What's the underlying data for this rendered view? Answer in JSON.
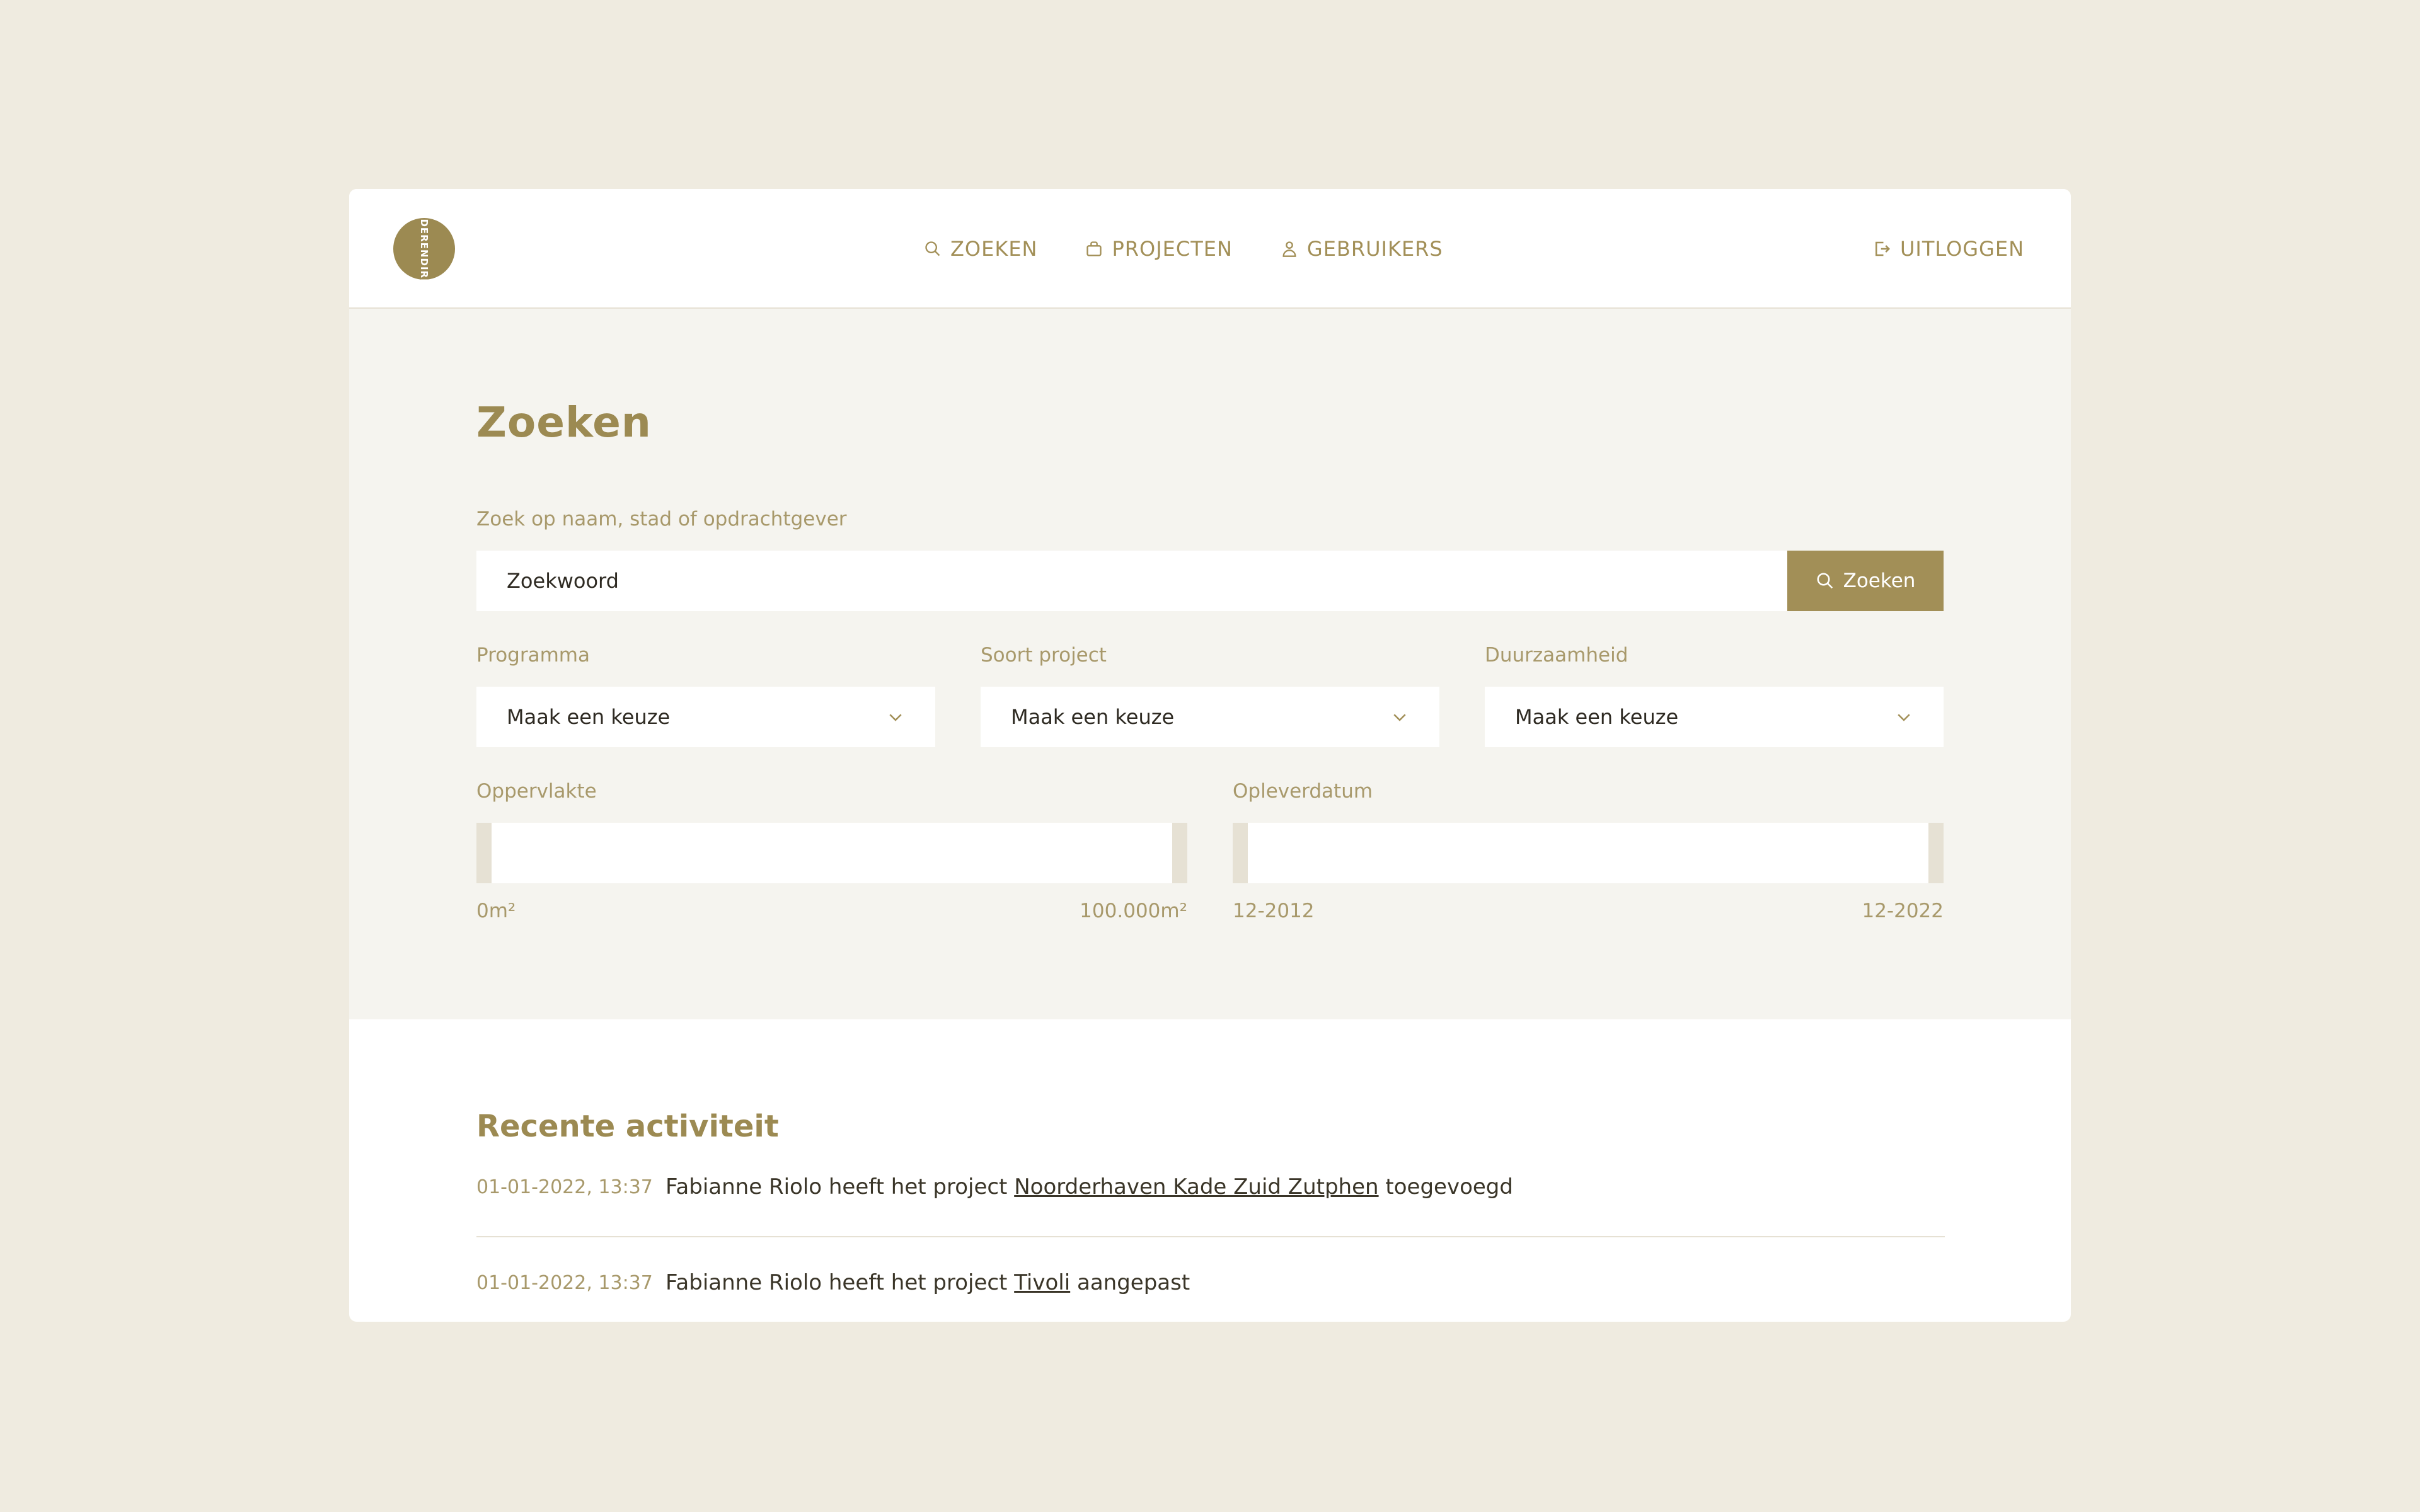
{
  "header": {
    "logo_text": "DIEDERENDIRRIX",
    "nav": [
      {
        "label": "ZOEKEN",
        "icon": "search-icon"
      },
      {
        "label": "PROJECTEN",
        "icon": "briefcase-icon"
      },
      {
        "label": "GEBRUIKERS",
        "icon": "user-icon"
      }
    ],
    "logout_label": "UITLOGGEN"
  },
  "search": {
    "title": "Zoeken",
    "query_label": "Zoek op naam, stad of opdrachtgever",
    "query_value": "Zoekwoord",
    "button_label": "Zoeken",
    "filters": [
      {
        "label": "Programma",
        "value": "Maak een keuze"
      },
      {
        "label": "Soort project",
        "value": "Maak een keuze"
      },
      {
        "label": "Duurzaamheid",
        "value": "Maak een keuze"
      }
    ],
    "ranges": [
      {
        "label": "Oppervlakte",
        "min": "0m²",
        "max": "100.000m²"
      },
      {
        "label": "Opleverdatum",
        "min": "12-2012",
        "max": "12-2022"
      }
    ]
  },
  "activity": {
    "title": "Recente activiteit",
    "items": [
      {
        "date": "01-01-2022, 13:37",
        "before": "Fabianne Riolo heeft het project",
        "link": "Noorderhaven Kade Zuid Zutphen",
        "after": "toegevoegd"
      },
      {
        "date": "01-01-2022, 13:37",
        "before": "Fabianne Riolo heeft het project",
        "link": "Tivoli",
        "after": "aangepast"
      }
    ]
  },
  "colors": {
    "background": "#efebe0",
    "accent": "#a28f57",
    "panel": "#f5f4ef"
  }
}
